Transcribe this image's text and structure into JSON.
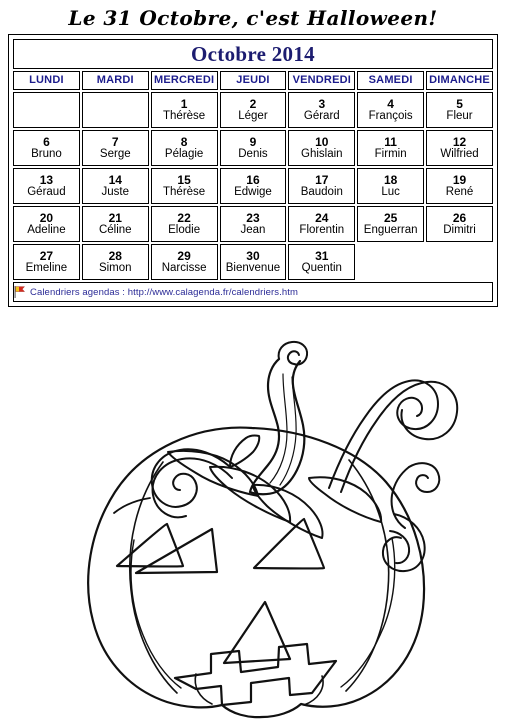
{
  "title": "Le 31 Octobre, c'est Halloween!",
  "calendar": {
    "month_header": "Octobre 2014",
    "weekdays": [
      "LUNDI",
      "MARDI",
      "MERCREDI",
      "JEUDI",
      "VENDREDI",
      "SAMEDI",
      "DIMANCHE"
    ],
    "weeks": [
      [
        {
          "num": "",
          "saint": ""
        },
        {
          "num": "",
          "saint": ""
        },
        {
          "num": "1",
          "saint": "Thérèse"
        },
        {
          "num": "2",
          "saint": "Léger"
        },
        {
          "num": "3",
          "saint": "Gérard"
        },
        {
          "num": "4",
          "saint": "François"
        },
        {
          "num": "5",
          "saint": "Fleur"
        }
      ],
      [
        {
          "num": "6",
          "saint": "Bruno"
        },
        {
          "num": "7",
          "saint": "Serge"
        },
        {
          "num": "8",
          "saint": "Pélagie"
        },
        {
          "num": "9",
          "saint": "Denis"
        },
        {
          "num": "10",
          "saint": "Ghislain"
        },
        {
          "num": "11",
          "saint": "Firmin"
        },
        {
          "num": "12",
          "saint": "Wilfried"
        }
      ],
      [
        {
          "num": "13",
          "saint": "Géraud"
        },
        {
          "num": "14",
          "saint": "Juste"
        },
        {
          "num": "15",
          "saint": "Thérèse"
        },
        {
          "num": "16",
          "saint": "Edwige"
        },
        {
          "num": "17",
          "saint": "Baudoin"
        },
        {
          "num": "18",
          "saint": "Luc"
        },
        {
          "num": "19",
          "saint": "René"
        }
      ],
      [
        {
          "num": "20",
          "saint": "Adeline"
        },
        {
          "num": "21",
          "saint": "Céline"
        },
        {
          "num": "22",
          "saint": "Elodie"
        },
        {
          "num": "23",
          "saint": "Jean"
        },
        {
          "num": "24",
          "saint": "Florentin"
        },
        {
          "num": "25",
          "saint": "Enguerran"
        },
        {
          "num": "26",
          "saint": "Dimitri"
        }
      ],
      [
        {
          "num": "27",
          "saint": "Emeline"
        },
        {
          "num": "28",
          "saint": "Simon"
        },
        {
          "num": "29",
          "saint": "Narcisse"
        },
        {
          "num": "30",
          "saint": "Bienvenue"
        },
        {
          "num": "31",
          "saint": "Quentin"
        },
        {
          "num": "",
          "saint": ""
        },
        {
          "num": "",
          "saint": ""
        }
      ]
    ],
    "footer": {
      "icon": "flag-icon",
      "text": "Calendriers agendas : http://www.calagenda.fr/calendriers.htm"
    }
  },
  "illustration": {
    "name": "jack-o-lantern-coloring-page",
    "description": "Black and white line-art jack-o'-lantern with stem, leaves and curling vine tendrils",
    "line_color": "#111111",
    "fill_color": "#ffffff"
  },
  "colors": {
    "heading_navy": "#1c1c70",
    "weekday_navy": "#1c1c8c",
    "link_blue": "#2a2a96",
    "border_black": "#000000",
    "title_black": "#000000",
    "flag_red": "#d42a1e",
    "flag_yellow": "#f5c518"
  }
}
